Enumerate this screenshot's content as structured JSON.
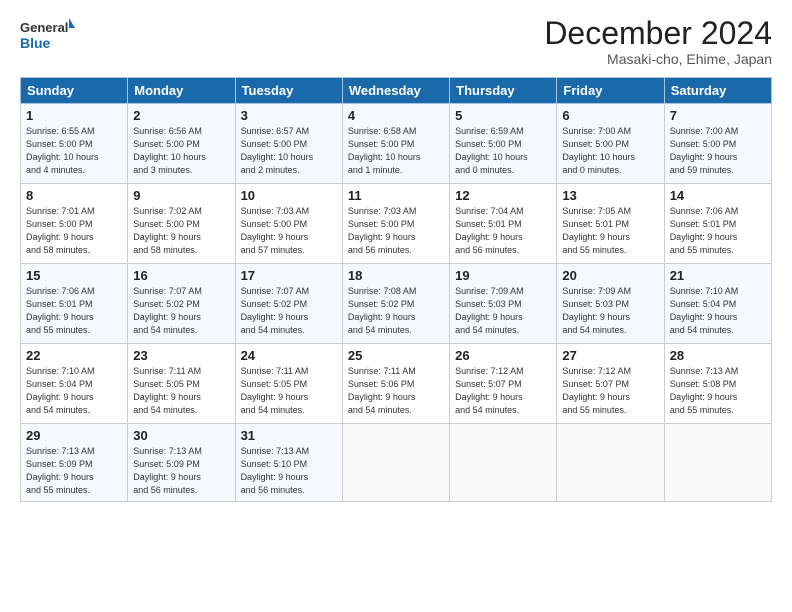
{
  "header": {
    "logo_line1": "General",
    "logo_line2": "Blue",
    "month_title": "December 2024",
    "subtitle": "Masaki-cho, Ehime, Japan"
  },
  "weekdays": [
    "Sunday",
    "Monday",
    "Tuesday",
    "Wednesday",
    "Thursday",
    "Friday",
    "Saturday"
  ],
  "weeks": [
    [
      {
        "day": "1",
        "info": "Sunrise: 6:55 AM\nSunset: 5:00 PM\nDaylight: 10 hours\nand 4 minutes."
      },
      {
        "day": "2",
        "info": "Sunrise: 6:56 AM\nSunset: 5:00 PM\nDaylight: 10 hours\nand 3 minutes."
      },
      {
        "day": "3",
        "info": "Sunrise: 6:57 AM\nSunset: 5:00 PM\nDaylight: 10 hours\nand 2 minutes."
      },
      {
        "day": "4",
        "info": "Sunrise: 6:58 AM\nSunset: 5:00 PM\nDaylight: 10 hours\nand 1 minute."
      },
      {
        "day": "5",
        "info": "Sunrise: 6:59 AM\nSunset: 5:00 PM\nDaylight: 10 hours\nand 0 minutes."
      },
      {
        "day": "6",
        "info": "Sunrise: 7:00 AM\nSunset: 5:00 PM\nDaylight: 10 hours\nand 0 minutes."
      },
      {
        "day": "7",
        "info": "Sunrise: 7:00 AM\nSunset: 5:00 PM\nDaylight: 9 hours\nand 59 minutes."
      }
    ],
    [
      {
        "day": "8",
        "info": "Sunrise: 7:01 AM\nSunset: 5:00 PM\nDaylight: 9 hours\nand 58 minutes."
      },
      {
        "day": "9",
        "info": "Sunrise: 7:02 AM\nSunset: 5:00 PM\nDaylight: 9 hours\nand 58 minutes."
      },
      {
        "day": "10",
        "info": "Sunrise: 7:03 AM\nSunset: 5:00 PM\nDaylight: 9 hours\nand 57 minutes."
      },
      {
        "day": "11",
        "info": "Sunrise: 7:03 AM\nSunset: 5:00 PM\nDaylight: 9 hours\nand 56 minutes."
      },
      {
        "day": "12",
        "info": "Sunrise: 7:04 AM\nSunset: 5:01 PM\nDaylight: 9 hours\nand 56 minutes."
      },
      {
        "day": "13",
        "info": "Sunrise: 7:05 AM\nSunset: 5:01 PM\nDaylight: 9 hours\nand 55 minutes."
      },
      {
        "day": "14",
        "info": "Sunrise: 7:06 AM\nSunset: 5:01 PM\nDaylight: 9 hours\nand 55 minutes."
      }
    ],
    [
      {
        "day": "15",
        "info": "Sunrise: 7:06 AM\nSunset: 5:01 PM\nDaylight: 9 hours\nand 55 minutes."
      },
      {
        "day": "16",
        "info": "Sunrise: 7:07 AM\nSunset: 5:02 PM\nDaylight: 9 hours\nand 54 minutes."
      },
      {
        "day": "17",
        "info": "Sunrise: 7:07 AM\nSunset: 5:02 PM\nDaylight: 9 hours\nand 54 minutes."
      },
      {
        "day": "18",
        "info": "Sunrise: 7:08 AM\nSunset: 5:02 PM\nDaylight: 9 hours\nand 54 minutes."
      },
      {
        "day": "19",
        "info": "Sunrise: 7:09 AM\nSunset: 5:03 PM\nDaylight: 9 hours\nand 54 minutes."
      },
      {
        "day": "20",
        "info": "Sunrise: 7:09 AM\nSunset: 5:03 PM\nDaylight: 9 hours\nand 54 minutes."
      },
      {
        "day": "21",
        "info": "Sunrise: 7:10 AM\nSunset: 5:04 PM\nDaylight: 9 hours\nand 54 minutes."
      }
    ],
    [
      {
        "day": "22",
        "info": "Sunrise: 7:10 AM\nSunset: 5:04 PM\nDaylight: 9 hours\nand 54 minutes."
      },
      {
        "day": "23",
        "info": "Sunrise: 7:11 AM\nSunset: 5:05 PM\nDaylight: 9 hours\nand 54 minutes."
      },
      {
        "day": "24",
        "info": "Sunrise: 7:11 AM\nSunset: 5:05 PM\nDaylight: 9 hours\nand 54 minutes."
      },
      {
        "day": "25",
        "info": "Sunrise: 7:11 AM\nSunset: 5:06 PM\nDaylight: 9 hours\nand 54 minutes."
      },
      {
        "day": "26",
        "info": "Sunrise: 7:12 AM\nSunset: 5:07 PM\nDaylight: 9 hours\nand 54 minutes."
      },
      {
        "day": "27",
        "info": "Sunrise: 7:12 AM\nSunset: 5:07 PM\nDaylight: 9 hours\nand 55 minutes."
      },
      {
        "day": "28",
        "info": "Sunrise: 7:13 AM\nSunset: 5:08 PM\nDaylight: 9 hours\nand 55 minutes."
      }
    ],
    [
      {
        "day": "29",
        "info": "Sunrise: 7:13 AM\nSunset: 5:09 PM\nDaylight: 9 hours\nand 55 minutes."
      },
      {
        "day": "30",
        "info": "Sunrise: 7:13 AM\nSunset: 5:09 PM\nDaylight: 9 hours\nand 56 minutes."
      },
      {
        "day": "31",
        "info": "Sunrise: 7:13 AM\nSunset: 5:10 PM\nDaylight: 9 hours\nand 56 minutes."
      },
      {
        "day": "",
        "info": ""
      },
      {
        "day": "",
        "info": ""
      },
      {
        "day": "",
        "info": ""
      },
      {
        "day": "",
        "info": ""
      }
    ]
  ]
}
